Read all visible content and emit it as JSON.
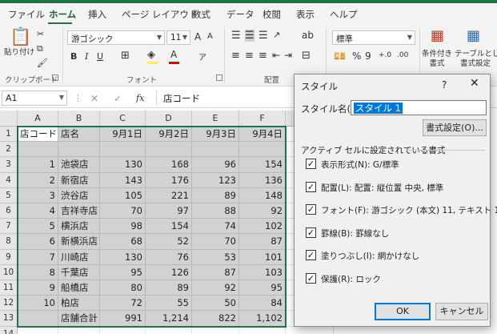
{
  "ribbon": {
    "tabs": [
      "ファイル",
      "ホーム",
      "挿入",
      "ページ レイアウト",
      "数式",
      "データ",
      "校閲",
      "表示",
      "ヘルプ"
    ],
    "active_tab": "ホーム",
    "clipboard": {
      "paste_label": "貼り付け",
      "group_label": "クリップボード"
    },
    "font": {
      "font_name": "游ゴシック",
      "font_size": "11",
      "grow": "A",
      "shrink": "A",
      "bold": "B",
      "italic": "I",
      "underline": "U",
      "group_label": "フォント",
      "font_color": "#e60000",
      "fill_color": "#ffff00"
    },
    "alignment": {
      "group_label": "配置"
    },
    "number": {
      "format": "標準",
      "percent": "%",
      "comma": "9"
    },
    "styles": {
      "conditional": "条件付き",
      "conditional2": "書式",
      "as_table": "テーブルとして",
      "as_table2": "書式設定"
    }
  },
  "formula_bar": {
    "name_box": "A1",
    "fx": "fx",
    "cancel": "✕",
    "enter": "✓",
    "content": "店コード"
  },
  "sheet": {
    "columns": [
      "A",
      "B",
      "C",
      "D",
      "E",
      "F"
    ],
    "extra_columns": [
      "G"
    ],
    "rows": [
      [
        "店コード",
        "店名",
        "9月1日",
        "9月2日",
        "9月3日",
        "9月4日"
      ],
      [
        "",
        "",
        "",
        "",
        "",
        ""
      ],
      [
        "1",
        "池袋店",
        "130",
        "168",
        "96",
        "154"
      ],
      [
        "2",
        "新宿店",
        "143",
        "176",
        "123",
        "136"
      ],
      [
        "3",
        "渋谷店",
        "105",
        "221",
        "89",
        "148"
      ],
      [
        "4",
        "吉祥寺店",
        "70",
        "97",
        "88",
        "92"
      ],
      [
        "5",
        "横浜店",
        "98",
        "154",
        "74",
        "102"
      ],
      [
        "6",
        "新横浜店",
        "68",
        "52",
        "70",
        "87"
      ],
      [
        "7",
        "川崎店",
        "130",
        "76",
        "53",
        "101"
      ],
      [
        "8",
        "千葉店",
        "95",
        "126",
        "87",
        "103"
      ],
      [
        "9",
        "船橋店",
        "80",
        "89",
        "92",
        "95"
      ],
      [
        "10",
        "柏店",
        "72",
        "55",
        "50",
        "84"
      ],
      [
        "",
        "店舗合計",
        "991",
        "1,214",
        "822",
        "1,102"
      ],
      [
        "",
        "",
        "",
        "",
        "",
        ""
      ]
    ],
    "row_numbers": [
      "1",
      "2",
      "3",
      "4",
      "5",
      "6",
      "7",
      "8",
      "9",
      "10",
      "11",
      "12",
      "13",
      "14"
    ]
  },
  "dialog": {
    "title": "スタイル",
    "help": "?",
    "close": "✕",
    "style_name_label": "スタイル名(S):",
    "style_name_value": "スタイル 1",
    "format_button": "書式設定(O)...",
    "section_label": "アクティブ セルに設定されている書式",
    "checks": [
      {
        "label": "表示形式(N): G/標準",
        "checked": true
      },
      {
        "label": "配置(L): 配置: 縦位置 中央, 標準",
        "checked": true
      },
      {
        "label": "フォント(F): 游ゴシック (本文) 11, テキスト 1",
        "checked": true
      },
      {
        "label": "罫線(B): 罫線なし",
        "checked": true
      },
      {
        "label": "塗りつぶし(I): 網かけなし",
        "checked": true
      },
      {
        "label": "保護(R): ロック",
        "checked": true
      }
    ],
    "ok": "OK",
    "cancel": "キャンセル"
  }
}
